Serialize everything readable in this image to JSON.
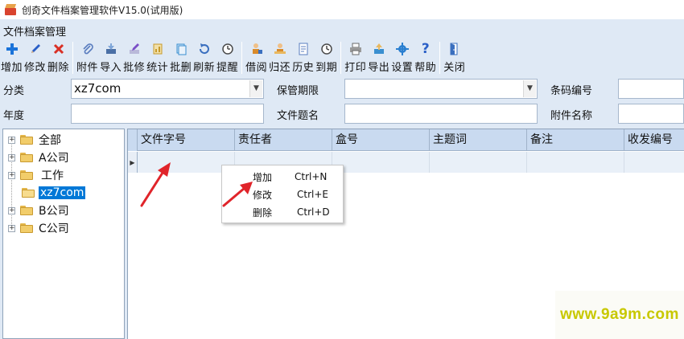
{
  "window": {
    "title": "创奇文件档案管理软件V15.0(试用版)"
  },
  "menu": {
    "items": [
      {
        "label": "文件档案管理"
      }
    ]
  },
  "toolbar": {
    "buttons": [
      {
        "label": "增加",
        "icon": "add-icon",
        "color": "#1a73d9"
      },
      {
        "label": "修改",
        "icon": "pencil-icon",
        "color": "#2a5fc7"
      },
      {
        "label": "删除",
        "icon": "delete-icon",
        "color": "#d93025"
      },
      {
        "label": "附件",
        "icon": "paperclip-icon",
        "color": "#5a7dbf"
      },
      {
        "label": "导入",
        "icon": "import-icon",
        "color": "#4a6fa5"
      },
      {
        "label": "批修",
        "icon": "batch-edit-icon",
        "color": "#7a4fc7"
      },
      {
        "label": "统计",
        "icon": "statistics-icon",
        "color": "#c79a2a"
      },
      {
        "label": "批删",
        "icon": "batch-delete-icon",
        "color": "#3a8fd0"
      },
      {
        "label": "刷新",
        "icon": "refresh-icon",
        "color": "#3a6fbf"
      },
      {
        "label": "提醒",
        "icon": "clock-icon",
        "color": "#4a4a4a"
      },
      {
        "label": "借阅",
        "icon": "borrow-icon",
        "color": "#d98a2a"
      },
      {
        "label": "归还",
        "icon": "return-icon",
        "color": "#d98a2a"
      },
      {
        "label": "历史",
        "icon": "history-icon",
        "color": "#5a7dbf"
      },
      {
        "label": "到期",
        "icon": "due-clock-icon",
        "color": "#4a4a4a"
      },
      {
        "label": "打印",
        "icon": "printer-icon",
        "color": "#6a6a6a"
      },
      {
        "label": "导出",
        "icon": "export-icon",
        "color": "#3a8fd0"
      },
      {
        "label": "设置",
        "icon": "gear-icon",
        "color": "#2a7fd0"
      },
      {
        "label": "帮助",
        "icon": "help-icon",
        "color": "#2a5fc7"
      },
      {
        "label": "关闭",
        "icon": "close-door-icon",
        "color": "#3a6fbf"
      }
    ]
  },
  "filters": {
    "category_label": "分类",
    "category_value": "xz7com",
    "retention_label": "保管期限",
    "retention_value": "",
    "barcode_label": "条码编号",
    "barcode_value": "",
    "year_label": "年度",
    "year_value": "",
    "title_label": "文件题名",
    "title_value": "",
    "attachment_label": "附件名称",
    "attachment_value": ""
  },
  "tree": {
    "items": [
      {
        "label": "全部",
        "expandable": true,
        "selected": false
      },
      {
        "label": "A公司",
        "expandable": true,
        "selected": false
      },
      {
        "label": "工作",
        "expandable": true,
        "selected": false
      },
      {
        "label": "xz7com",
        "expandable": false,
        "selected": true
      },
      {
        "label": "B公司",
        "expandable": true,
        "selected": false
      },
      {
        "label": "C公司",
        "expandable": true,
        "selected": false
      }
    ]
  },
  "grid": {
    "columns": [
      "文件字号",
      "责任者",
      "盒号",
      "主题词",
      "备注",
      "收发编号"
    ]
  },
  "context_menu": {
    "items": [
      {
        "label": "增加",
        "shortcut": "Ctrl+N"
      },
      {
        "label": "修改",
        "shortcut": "Ctrl+E"
      },
      {
        "label": "删除",
        "shortcut": "Ctrl+D"
      }
    ]
  },
  "watermark": {
    "text": "www.9a9m.com"
  },
  "colors": {
    "accent": "#0078d7",
    "arrow": "#e0242a",
    "header_bg": "#c9daf0",
    "panel_bg": "#dfe9f5"
  }
}
